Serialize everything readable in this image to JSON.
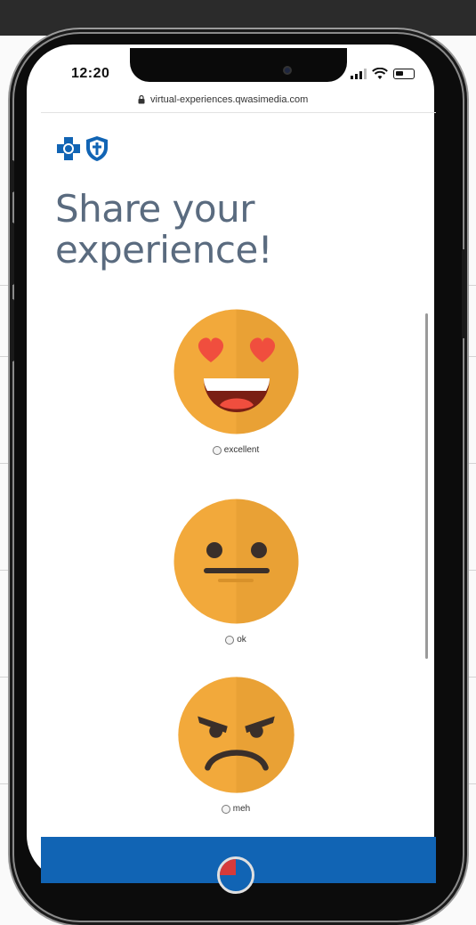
{
  "status_bar": {
    "time": "12:20"
  },
  "browser": {
    "url": "virtual-experiences.qwasimedia.com"
  },
  "page": {
    "headline_line1": "Share your",
    "headline_line2": "experience!"
  },
  "options": [
    {
      "label": "excellent",
      "icon": "heart-eyes-face-icon"
    },
    {
      "label": "ok",
      "icon": "neutral-face-icon"
    },
    {
      "label": "meh",
      "icon": "angry-face-icon"
    }
  ],
  "colors": {
    "headline": "#5a6b7f",
    "emoji": "#f2a93b",
    "heart": "#f04e3e",
    "brand_blue": "#1164b4",
    "bottom_bar": "#1164b4"
  }
}
